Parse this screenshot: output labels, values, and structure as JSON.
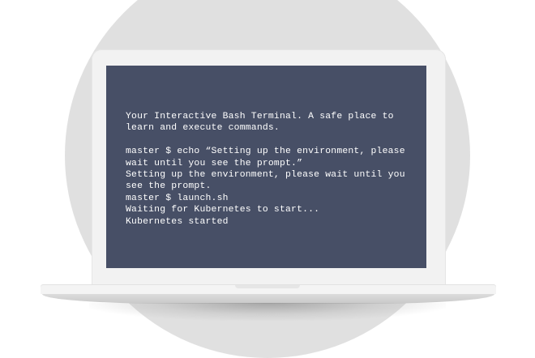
{
  "terminal": {
    "lines": [
      "Your Interactive Bash Terminal. A safe place to",
      "learn and execute commands.",
      "",
      "master $ echo “Setting up the environment, please",
      "wait until you see the prompt.”",
      "Setting up the environment, please wait until you",
      "see the prompt.",
      "master $ launch.sh",
      "Waiting for Kubernetes to start...",
      "Kubernetes started"
    ]
  },
  "colors": {
    "screen_background": "#474f66",
    "terminal_text": "#ffffff",
    "laptop_body": "#f2f2f2",
    "backdrop_circle": "#e0e0e0"
  }
}
